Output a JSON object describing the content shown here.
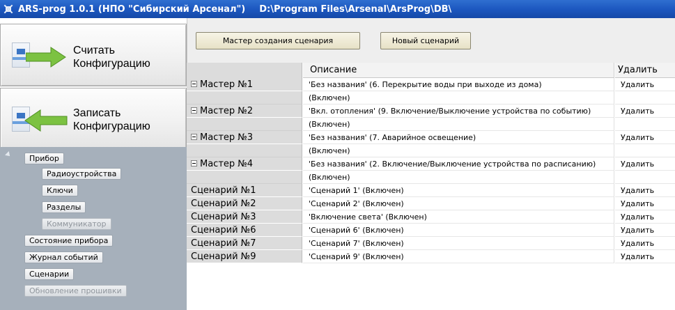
{
  "window": {
    "title": "ARS-prog 1.0.1 (НПО \"Сибирский Арсенал\")",
    "path": "D:\\Program Files\\Arsenal\\ArsProg\\DB\\"
  },
  "left": {
    "read_button": {
      "line1": "Считать",
      "line2": "Конфигурацию"
    },
    "write_button": {
      "line1": "Записать",
      "line2": "Конфигурацию"
    },
    "tree": {
      "device": "Прибор",
      "radio": "Радиоустройства",
      "keys": "Ключи",
      "sections": "Разделы",
      "communicator": "Коммуникатор",
      "state": "Состояние прибора",
      "journal": "Журнал событий",
      "scenarios": "Сценарии",
      "firmware": "Обновление прошивки"
    }
  },
  "toolbar": {
    "master_label": "Мастер создания сценария",
    "new_label": "Новый сценарий"
  },
  "table": {
    "headers": {
      "description": "Описание",
      "delete": "Удалить"
    },
    "rows": [
      {
        "name": "Мастер №1",
        "desc": "'Без названия'  (6. Перекрытие воды при выходе из дома)",
        "del": "Удалить",
        "sub": "(Включен)"
      },
      {
        "name": "Мастер №2",
        "desc": "'Вкл. отопления'  (9. Включение/Выключение устройства по событию)",
        "del": "Удалить",
        "sub": "(Включен)"
      },
      {
        "name": "Мастер №3",
        "desc": "'Без названия'  (7. Аварийное освещение)",
        "del": "Удалить",
        "sub": "(Включен)"
      },
      {
        "name": "Мастер №4",
        "desc": "'Без названия'  (2. Включение/Выключение устройства по расписанию)",
        "del": "Удалить",
        "sub": "(Включен)"
      },
      {
        "name": "Сценарий №1",
        "desc": "'Сценарий 1'   (Включен)",
        "del": "Удалить"
      },
      {
        "name": "Сценарий №2",
        "desc": "'Сценарий 2'   (Включен)",
        "del": "Удалить"
      },
      {
        "name": "Сценарий №3",
        "desc": "'Включение света'   (Включен)",
        "del": "Удалить"
      },
      {
        "name": "Сценарий №6",
        "desc": "'Сценарий 6'   (Включен)",
        "del": "Удалить"
      },
      {
        "name": "Сценарий №7",
        "desc": "'Сценарий 7'   (Включен)",
        "del": "Удалить"
      },
      {
        "name": "Сценарий №9",
        "desc": "'Сценарий 9'   (Включен)",
        "del": "Удалить"
      }
    ]
  },
  "colors": {
    "titlebar": "#1d58c0",
    "tree_bg": "#a6b0bb",
    "arrow_green": "#7cc242",
    "row_header_bg": "#dcdcdc",
    "toolbar_button_bg": "#efe9d2"
  },
  "icons": {
    "app": "ars-app-icon",
    "read": "device-arrow-right-icon",
    "write": "device-arrow-left-icon",
    "collapse": "collapse-minus-icon"
  }
}
